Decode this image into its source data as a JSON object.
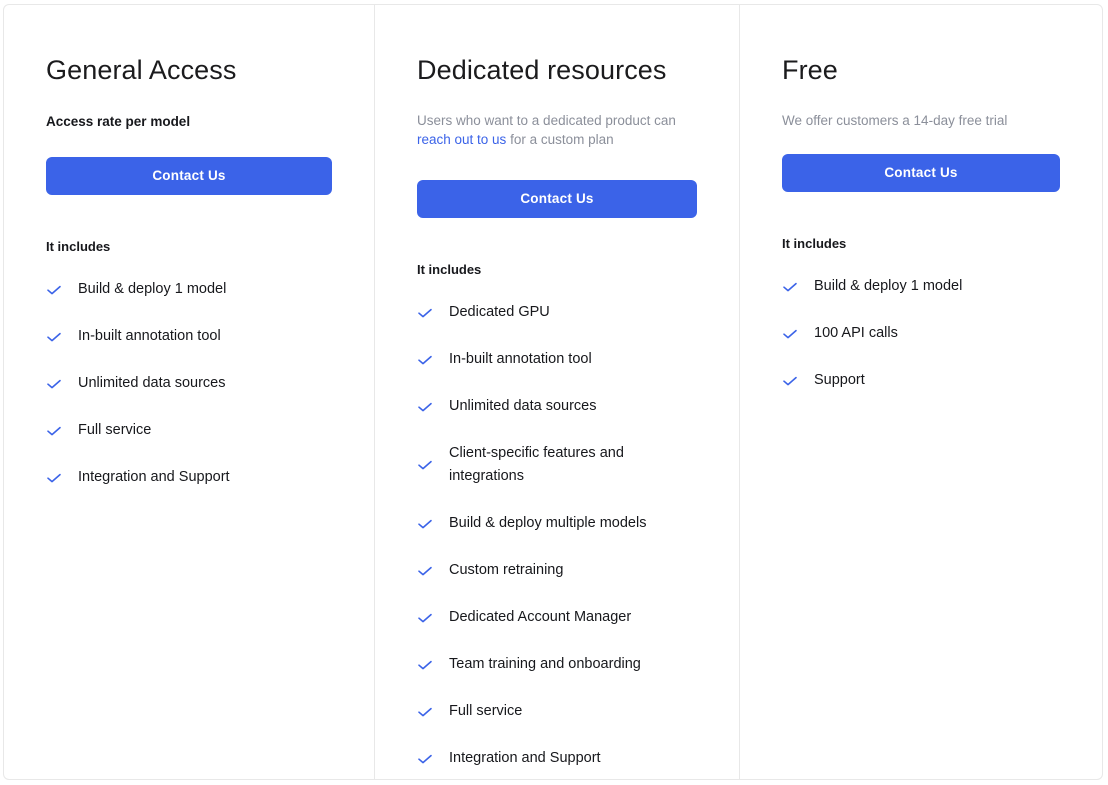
{
  "accent_color": "#3b63e8",
  "link_color": "#3b63e8",
  "muted_text_color": "#8b8f9a",
  "text_color": "#17181c",
  "border_color": "#e8e8e8",
  "check_icon_name": "check-icon",
  "plans": [
    {
      "title": "General Access",
      "subtitle_style": "strong",
      "subtitle": "Access rate per model",
      "subtitle_parts": {
        "before": "",
        "link": "",
        "after": ""
      },
      "button_label": "Contact Us",
      "includes_heading": "It includes",
      "features": [
        "Build & deploy 1 model",
        "In-built annotation tool",
        "Unlimited data sources",
        "Full service",
        "Integration and Support"
      ]
    },
    {
      "title": "Dedicated resources",
      "subtitle_style": "muted",
      "subtitle": "Users who want to a dedicated product can reach out to us for a custom plan",
      "subtitle_parts": {
        "before": "Users who want to a dedicated product can ",
        "link": "reach out to us",
        "after": " for a custom plan"
      },
      "button_label": "Contact Us",
      "includes_heading": "It includes",
      "features": [
        "Dedicated GPU",
        "In-built annotation tool",
        "Unlimited data sources",
        "Client-specific features and integrations",
        "Build & deploy multiple models",
        "Custom retraining",
        "Dedicated Account Manager",
        "Team training and onboarding",
        "Full service",
        "Integration and Support"
      ]
    },
    {
      "title": "Free",
      "subtitle_style": "muted",
      "subtitle": "We offer customers a 14-day free trial",
      "subtitle_parts": {
        "before": "We offer customers a 14-day free trial",
        "link": "",
        "after": ""
      },
      "button_label": "Contact Us",
      "includes_heading": "It includes",
      "features": [
        "Build & deploy 1 model",
        "100 API calls",
        "Support"
      ]
    }
  ]
}
